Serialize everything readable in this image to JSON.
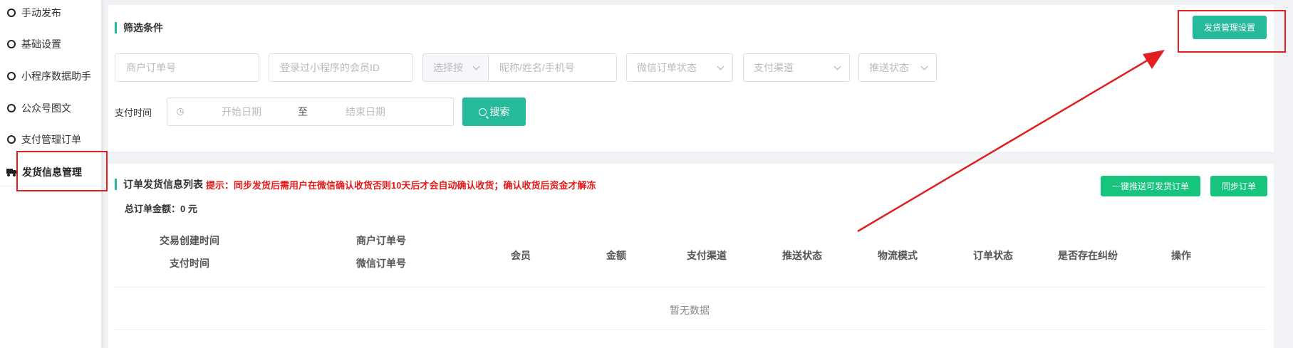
{
  "sidebar": {
    "items": [
      {
        "label": "手动发布"
      },
      {
        "label": "基础设置"
      },
      {
        "label": "小程序数据助手"
      },
      {
        "label": "公众号图文"
      },
      {
        "label": "支付管理订单"
      },
      {
        "label": "发货信息管理"
      }
    ]
  },
  "filter": {
    "title": "筛选条件",
    "settings_button": "发货管理设置",
    "merchant_order_placeholder": "商户订单号",
    "member_id_placeholder": "登录过小程序的会员ID",
    "select_by_placeholder": "选择按",
    "nickname_placeholder": "昵称/姓名/手机号",
    "wechat_status_placeholder": "微信订单状态",
    "pay_channel_placeholder": "支付渠道",
    "push_status_placeholder": "推送状态",
    "pay_time_label": "支付时间",
    "start_date_placeholder": "开始日期",
    "date_separator": "至",
    "end_date_placeholder": "结束日期",
    "search_button": "搜索"
  },
  "list": {
    "title": "订单发货信息列表",
    "hint": "提示：同步发货后需用户在微信确认收货否则10天后才会自动确认收货；确认收货后资金才解冻",
    "total_label": "总订单金额：",
    "total_value": "0 元",
    "push_all_button": "一键推送可发货订单",
    "sync_button": "同步订单",
    "columns": {
      "create_time": "交易创建时间",
      "pay_time": "支付时间",
      "merchant_order": "商户订单号",
      "wechat_order": "微信订单号",
      "member": "会员",
      "amount": "金额",
      "pay_channel": "支付渠道",
      "push_status": "推送状态",
      "logistics": "物流模式",
      "order_status": "订单状态",
      "dispute": "是否存在纠纷",
      "action": "操作"
    },
    "empty_text": "暂无数据"
  },
  "colors": {
    "accent": "#26b99a",
    "annotation": "#e02020"
  }
}
